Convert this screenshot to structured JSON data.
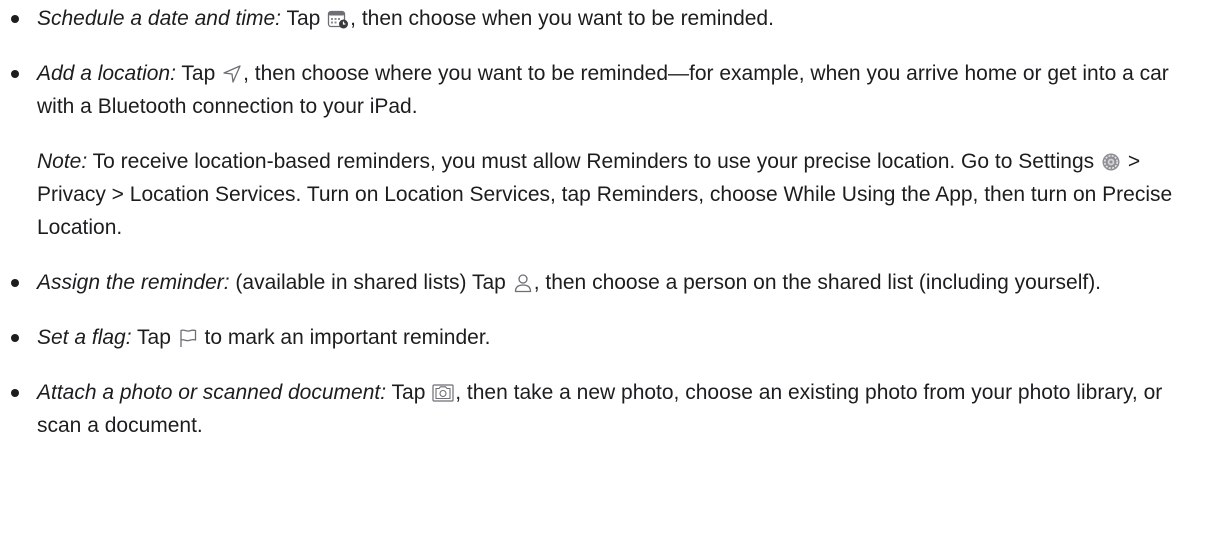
{
  "items": [
    {
      "lead": "Schedule a date and time:",
      "before_icon": " Tap ",
      "icon": "calendar-clock-icon",
      "after_icon": ", then choose when you want to be reminded."
    },
    {
      "lead": "Add a location:",
      "before_icon": " Tap ",
      "icon": "location-arrow-icon",
      "after_icon": ", then choose where you want to be reminded—for example, when you arrive home or get into a car with a Bluetooth connection to your iPad.",
      "note": {
        "lead": "Note:",
        "before_icon": " To receive location-based reminders, you must allow Reminders to use your precise location. Go to Settings ",
        "icon": "settings-gear-icon",
        "after_icon": " > Privacy > Location Services. Turn on Location Services, tap Reminders, choose While Using the App, then turn on Precise Location."
      }
    },
    {
      "lead": "Assign the reminder:",
      "before_icon": " (available in shared lists) Tap ",
      "icon": "person-icon",
      "after_icon": ", then choose a person on the shared list (including yourself)."
    },
    {
      "lead": "Set a flag:",
      "before_icon": " Tap ",
      "icon": "flag-icon",
      "after_icon": " to mark an important reminder."
    },
    {
      "lead": "Attach a photo or scanned document:",
      "before_icon": " Tap ",
      "icon": "camera-icon",
      "after_icon": ", then take a new photo, choose an existing photo from your photo library, or scan a document."
    }
  ]
}
